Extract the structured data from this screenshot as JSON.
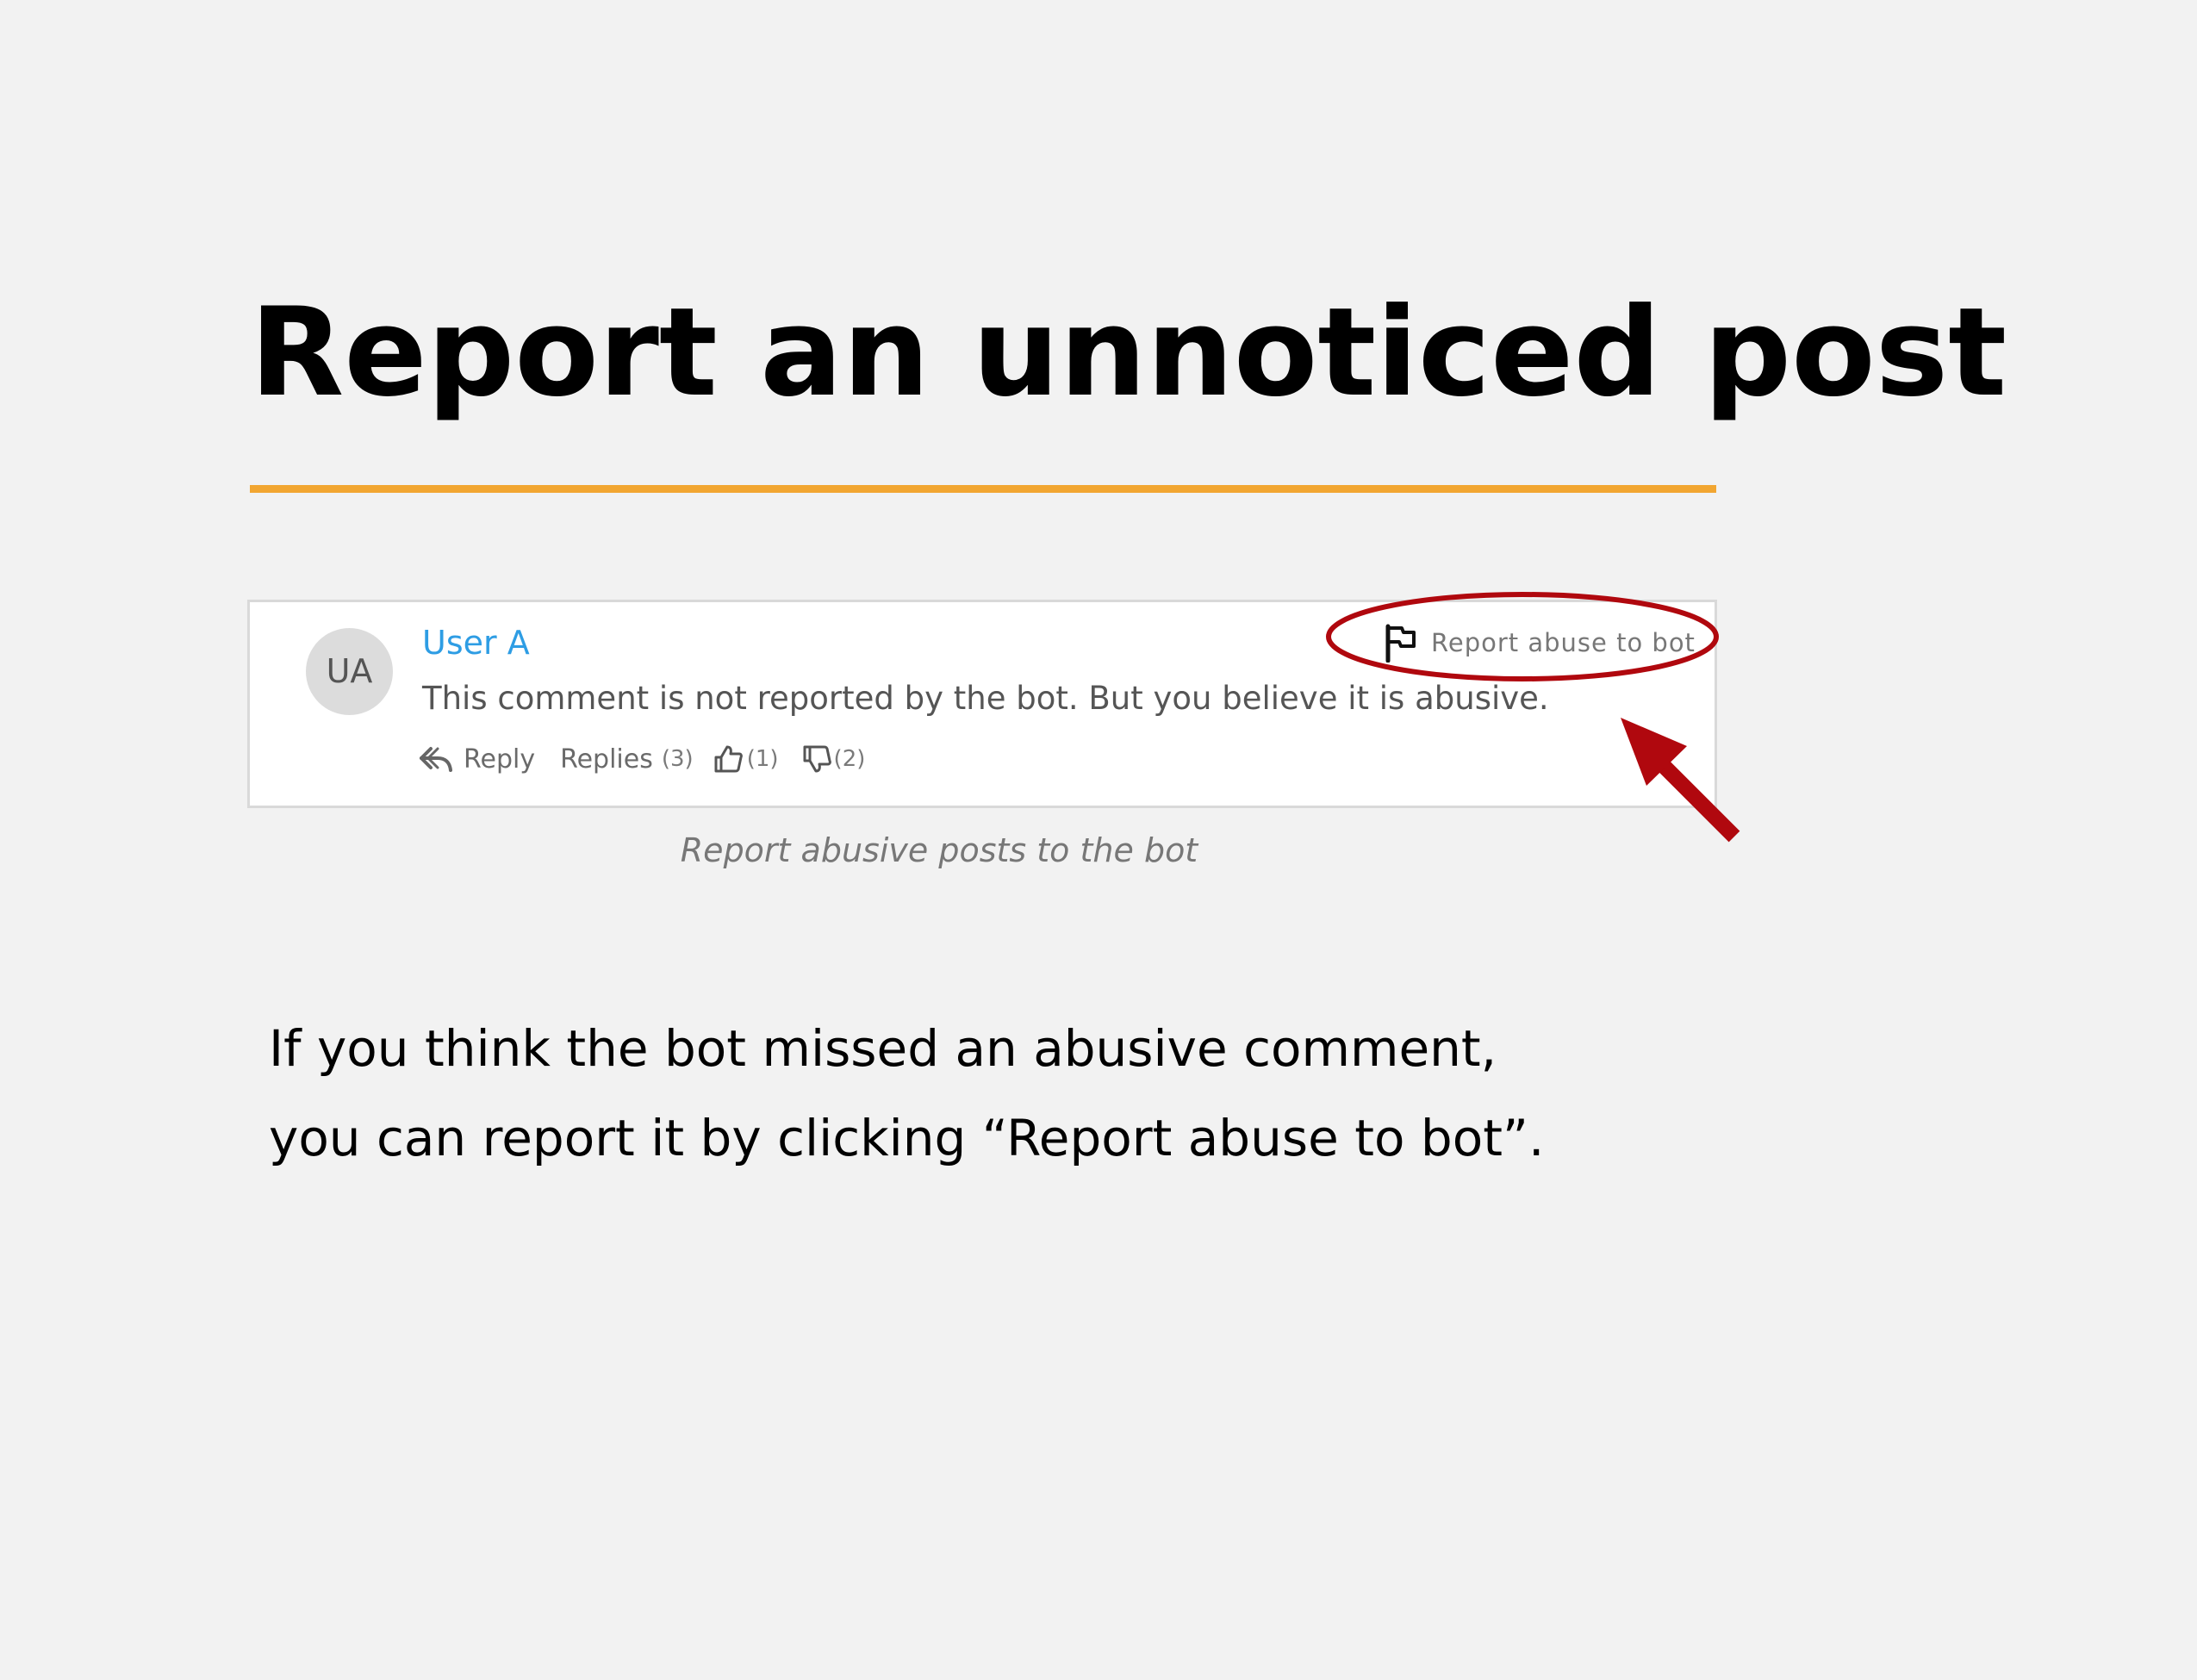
{
  "slide": {
    "title": "Report an unnoticed post",
    "accent_color": "#f2a631",
    "caption": "Report abusive posts to the bot",
    "body_lines": [
      "If you think the bot missed an abusive comment,",
      "you can report it by clicking “Report abuse to bot”."
    ],
    "highlight_color": "#b0080e"
  },
  "comment": {
    "avatar_initials": "UA",
    "user_name": "User A",
    "text": "This comment is not reported by the bot. But you believe it is abusive.",
    "report_label": "Report abuse to bot",
    "report_icon": "flag-icon",
    "actions": {
      "reply_label": "Reply",
      "reply_icon": "reply-arrow-icon",
      "replies_label": "Replies",
      "replies_count": "(3)",
      "like_icon": "thumbs-up-icon",
      "like_count": "(1)",
      "dislike_icon": "thumbs-down-icon",
      "dislike_count": "(2)"
    },
    "name_color": "#2e9de4"
  }
}
